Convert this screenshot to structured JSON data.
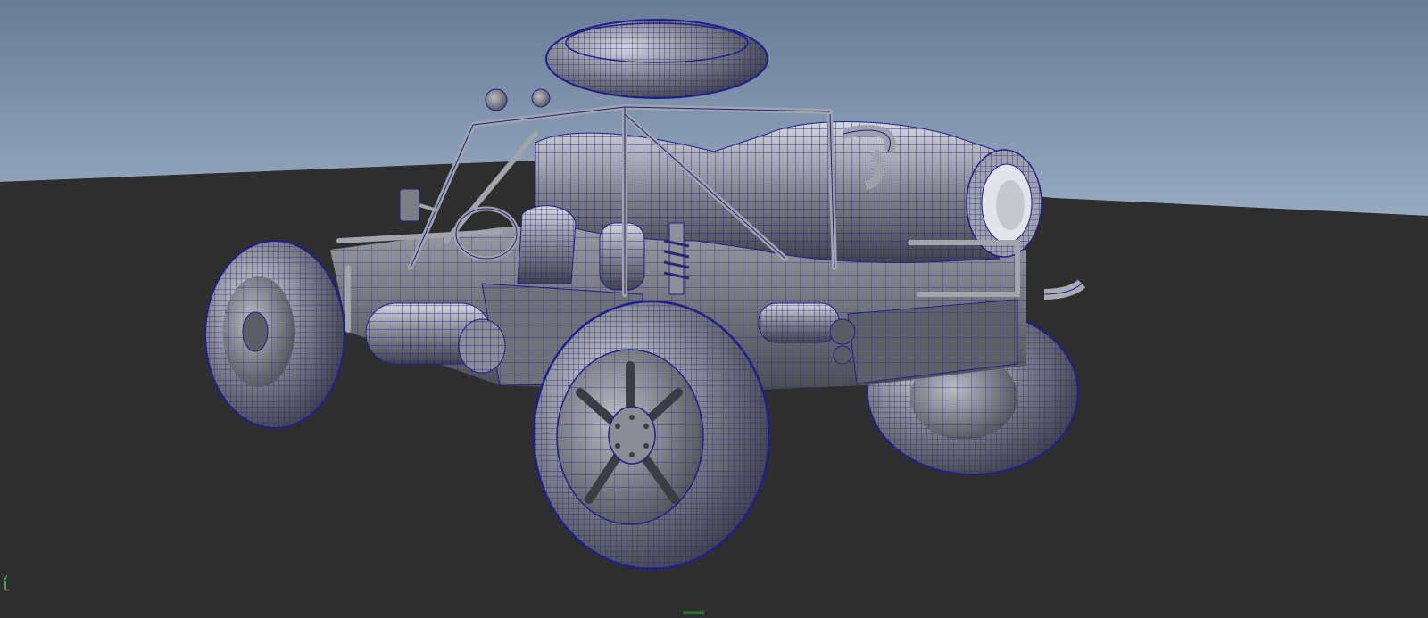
{
  "viewport": {
    "panel": "perspective-viewport",
    "display_mode": "wireframe-on-shaded",
    "camera": "perspective",
    "colors": {
      "sky_top": "#6c7f99",
      "sky_horizon": "#94a8c0",
      "ground": "#2e2e2e",
      "mesh_fill": "#7b7e86",
      "mesh_highlight": "#c9ccd3",
      "mesh_shadow": "#3c3e45",
      "wireframe": "#1f1f8c",
      "axis_x": "#d83a3a",
      "axis_y": "#46d146",
      "axis_z": "#4f7ef2"
    },
    "model": {
      "name": "dune-buggy",
      "parts": [
        "spare-tire",
        "jet-engine",
        "roll-cage",
        "front-left-wheel",
        "front-right-wheel",
        "rear-left-wheel",
        "rear-right-wheel",
        "seat",
        "steering-wheel",
        "fuel-tanks",
        "shock-absorber",
        "mirror",
        "lights",
        "exhaust"
      ]
    }
  },
  "axis_gizmo": {
    "y_label": "y",
    "icon": "view-axis-icon"
  }
}
